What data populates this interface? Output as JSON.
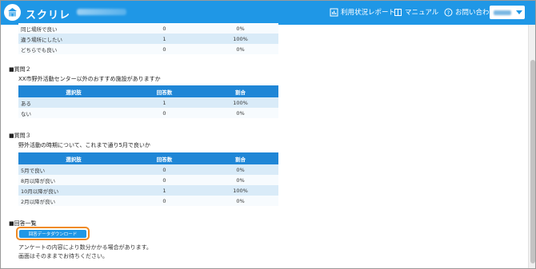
{
  "header": {
    "brand": "スクリレ",
    "nav": {
      "report": "利用状況レポート",
      "manual": "マニュアル",
      "contact": "お問い合わせ"
    }
  },
  "q1_tail": {
    "rows": [
      {
        "choice": "同じ場所で良い",
        "count": "0",
        "rate": "0%"
      },
      {
        "choice": "違う場所にしたい",
        "count": "1",
        "rate": "100%"
      },
      {
        "choice": "どちらでも良い",
        "count": "0",
        "rate": "0%"
      }
    ]
  },
  "q2": {
    "title": "■質問２",
    "text": "XX市野外活動センター以外のおすすめ施設がありますか",
    "headers": {
      "choice": "選択肢",
      "count": "回答数",
      "rate": "割合"
    },
    "rows": [
      {
        "choice": "ある",
        "count": "1",
        "rate": "100%"
      },
      {
        "choice": "ない",
        "count": "0",
        "rate": "0%"
      }
    ]
  },
  "q3": {
    "title": "■質問３",
    "text": "野外活動の時期について、これまで通り5月で良いか",
    "headers": {
      "choice": "選択肢",
      "count": "回答数",
      "rate": "割合"
    },
    "rows": [
      {
        "choice": "5月で良い",
        "count": "0",
        "rate": "0%"
      },
      {
        "choice": "8月以降が良い",
        "count": "0",
        "rate": "0%"
      },
      {
        "choice": "10月以降が良い",
        "count": "1",
        "rate": "100%"
      },
      {
        "choice": "2月以降が良い",
        "count": "0",
        "rate": "0%"
      }
    ]
  },
  "answers": {
    "title": "■回答一覧",
    "download_label": "回答データダウンロード",
    "note_line1": "アンケートの内容により数分かかる場合があります。",
    "note_line2": "画面はそのままでお待ちください。"
  }
}
